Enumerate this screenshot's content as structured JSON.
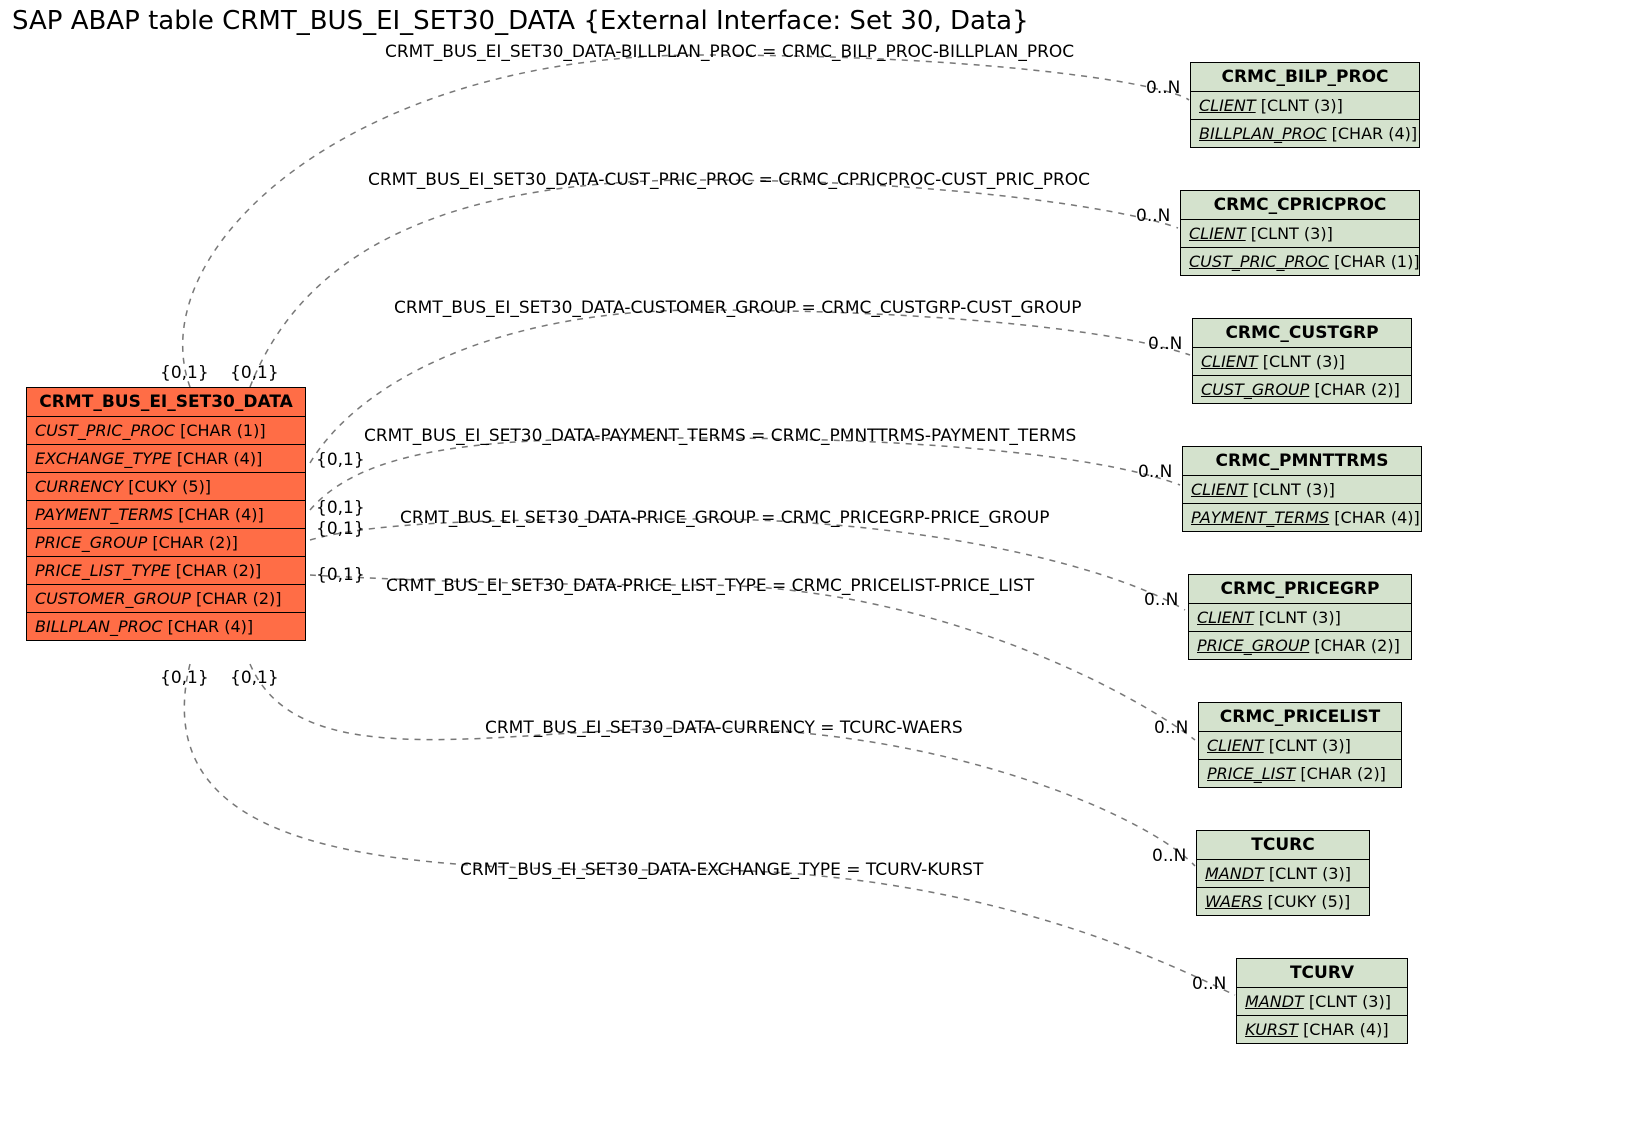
{
  "title": "SAP ABAP table CRMT_BUS_EI_SET30_DATA {External Interface: Set 30, Data}",
  "main": {
    "name": "CRMT_BUS_EI_SET30_DATA",
    "fields": [
      {
        "name": "CUST_PRIC_PROC",
        "type": "[CHAR (1)]"
      },
      {
        "name": "EXCHANGE_TYPE",
        "type": "[CHAR (4)]"
      },
      {
        "name": "CURRENCY",
        "type": "[CUKY (5)]"
      },
      {
        "name": "PAYMENT_TERMS",
        "type": "[CHAR (4)]"
      },
      {
        "name": "PRICE_GROUP",
        "type": "[CHAR (2)]"
      },
      {
        "name": "PRICE_LIST_TYPE",
        "type": "[CHAR (2)]"
      },
      {
        "name": "CUSTOMER_GROUP",
        "type": "[CHAR (2)]"
      },
      {
        "name": "BILLPLAN_PROC",
        "type": "[CHAR (4)]"
      }
    ]
  },
  "refs": [
    {
      "name": "CRMC_BILP_PROC",
      "fields": [
        {
          "name": "CLIENT",
          "type": "[CLNT (3)]",
          "u": true
        },
        {
          "name": "BILLPLAN_PROC",
          "type": "[CHAR (4)]",
          "u": true
        }
      ]
    },
    {
      "name": "CRMC_CPRICPROC",
      "fields": [
        {
          "name": "CLIENT",
          "type": "[CLNT (3)]",
          "u": true
        },
        {
          "name": "CUST_PRIC_PROC",
          "type": "[CHAR (1)]",
          "u": true
        }
      ]
    },
    {
      "name": "CRMC_CUSTGRP",
      "fields": [
        {
          "name": "CLIENT",
          "type": "[CLNT (3)]",
          "u": true
        },
        {
          "name": "CUST_GROUP",
          "type": "[CHAR (2)]",
          "u": true
        }
      ]
    },
    {
      "name": "CRMC_PMNTTRMS",
      "fields": [
        {
          "name": "CLIENT",
          "type": "[CLNT (3)]",
          "u": true
        },
        {
          "name": "PAYMENT_TERMS",
          "type": "[CHAR (4)]",
          "u": true
        }
      ]
    },
    {
      "name": "CRMC_PRICEGRP",
      "fields": [
        {
          "name": "CLIENT",
          "type": "[CLNT (3)]",
          "u": true
        },
        {
          "name": "PRICE_GROUP",
          "type": "[CHAR (2)]",
          "u": true
        }
      ]
    },
    {
      "name": "CRMC_PRICELIST",
      "fields": [
        {
          "name": "CLIENT",
          "type": "[CLNT (3)]",
          "u": true
        },
        {
          "name": "PRICE_LIST",
          "type": "[CHAR (2)]",
          "u": true
        }
      ]
    },
    {
      "name": "TCURC",
      "fields": [
        {
          "name": "MANDT",
          "type": "[CLNT (3)]",
          "u": true
        },
        {
          "name": "WAERS",
          "type": "[CUKY (5)]",
          "u": true
        }
      ]
    },
    {
      "name": "TCURV",
      "fields": [
        {
          "name": "MANDT",
          "type": "[CLNT (3)]",
          "u": true
        },
        {
          "name": "KURST",
          "type": "[CHAR (4)]",
          "u": true
        }
      ]
    }
  ],
  "rels": [
    {
      "label": "CRMT_BUS_EI_SET30_DATA-BILLPLAN_PROC = CRMC_BILP_PROC-BILLPLAN_PROC"
    },
    {
      "label": "CRMT_BUS_EI_SET30_DATA-CUST_PRIC_PROC = CRMC_CPRICPROC-CUST_PRIC_PROC"
    },
    {
      "label": "CRMT_BUS_EI_SET30_DATA-CUSTOMER_GROUP = CRMC_CUSTGRP-CUST_GROUP"
    },
    {
      "label": "CRMT_BUS_EI_SET30_DATA-PAYMENT_TERMS = CRMC_PMNTTRMS-PAYMENT_TERMS"
    },
    {
      "label": "CRMT_BUS_EI_SET30_DATA-PRICE_GROUP = CRMC_PRICEGRP-PRICE_GROUP"
    },
    {
      "label": "CRMT_BUS_EI_SET30_DATA-PRICE_LIST_TYPE = CRMC_PRICELIST-PRICE_LIST"
    },
    {
      "label": "CRMT_BUS_EI_SET30_DATA-CURRENCY = TCURC-WAERS"
    },
    {
      "label": "CRMT_BUS_EI_SET30_DATA-EXCHANGE_TYPE = TCURV-KURST"
    }
  ],
  "cards": {
    "left_top_a": "{0,1}",
    "left_top_b": "{0,1}",
    "left_mid_a": "{0,1}",
    "left_mid_b": "{0,1}",
    "left_mid_c": "{0,1}",
    "left_mid_d": "{0,1}",
    "left_bot_a": "{0,1}",
    "left_bot_b": "{0,1}",
    "right": "0..N"
  }
}
